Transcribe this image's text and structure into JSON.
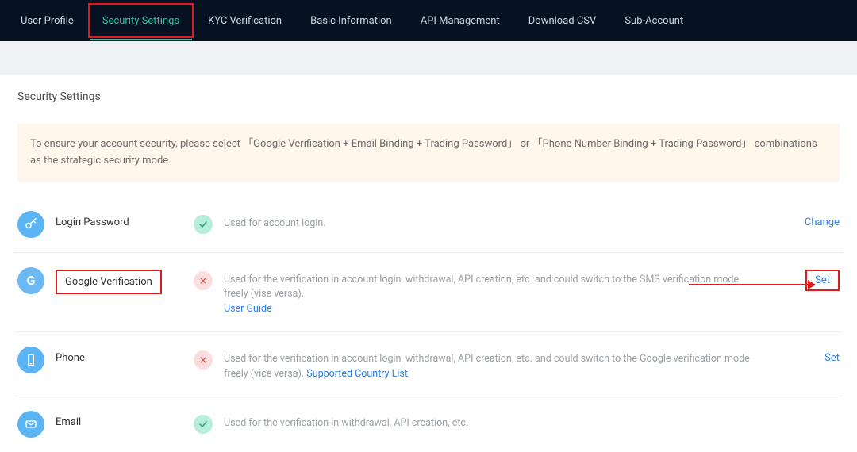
{
  "nav": {
    "items": [
      {
        "label": "User Profile"
      },
      {
        "label": "Security Settings"
      },
      {
        "label": "KYC Verification"
      },
      {
        "label": "Basic Information"
      },
      {
        "label": "API Management"
      },
      {
        "label": "Download CSV"
      },
      {
        "label": "Sub-Account"
      }
    ]
  },
  "page": {
    "title": "Security Settings"
  },
  "notice": {
    "text": "To ensure your account security, please select 「Google Verification + Email Binding + Trading Password」 or 「Phone Number Binding + Trading Password」 combinations as the strategic security mode."
  },
  "rows": {
    "login_password": {
      "title": "Login Password",
      "desc": "Used for account login.",
      "action": "Change"
    },
    "google": {
      "title": "Google Verification",
      "desc1": "Used for the verification in account login, withdrawal, API creation, etc. and could switch to the SMS verification mode freely (vise versa). ",
      "link": "User Guide",
      "action": "Set"
    },
    "phone": {
      "title": "Phone",
      "desc1": "Used for the verification in account login, withdrawal, API creation, etc. and could switch to the Google verification mode freely (vice versa). ",
      "link": "Supported Country List",
      "action": "Set"
    },
    "email": {
      "title": "Email",
      "desc": "Used for the verification in withdrawal, API creation, etc."
    }
  }
}
